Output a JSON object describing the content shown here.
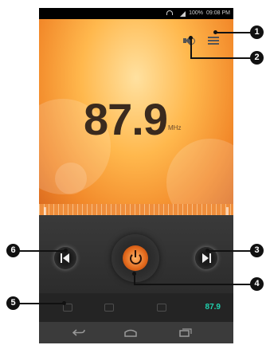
{
  "status_bar": {
    "battery": "100%",
    "time": "09:08 PM"
  },
  "radio": {
    "frequency": "87.9",
    "unit": "MHz"
  },
  "preset_bar": {
    "current_frequency": "87.9"
  },
  "callouts": [
    "1",
    "2",
    "3",
    "4",
    "5",
    "6"
  ],
  "icons": {
    "speaker": "speaker-icon",
    "menu": "menu-icon",
    "seek_previous": "seek-previous-icon",
    "seek_next": "seek-next-icon",
    "power": "power-icon",
    "back": "back-icon",
    "home": "home-icon",
    "recent": "recent-apps-icon"
  },
  "colors": {
    "screen_accent": "#f2892a",
    "preset_text": "#1fd0ad",
    "callout": "#111111"
  }
}
